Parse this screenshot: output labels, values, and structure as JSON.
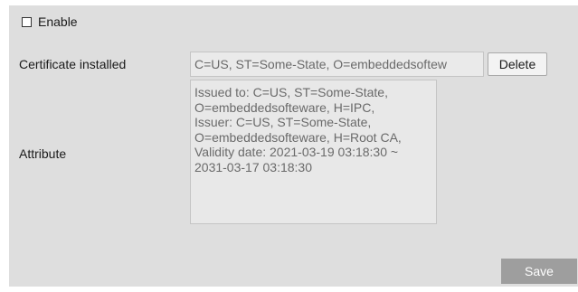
{
  "enable": {
    "label": "Enable",
    "checked": false
  },
  "certificate": {
    "label": "Certificate installed",
    "value": "C=US, ST=Some-State, O=embeddedsoftew",
    "delete_label": "Delete"
  },
  "attribute": {
    "label": "Attribute",
    "text": "Issued to: C=US, ST=Some-State,\nO=embeddedsofteware, H=IPC,\nIssuer: C=US, ST=Some-State,\nO=embeddedsofteware, H=Root CA,\nValidity date: 2021-03-19 03:18:30 ~\n2031-03-17 03:18:30"
  },
  "actions": {
    "save_label": "Save"
  }
}
